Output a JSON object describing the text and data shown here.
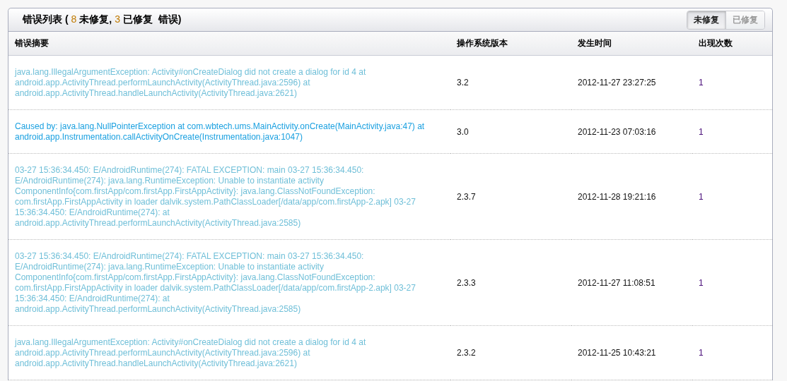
{
  "panel": {
    "title": {
      "label": "错误列表",
      "open": "(",
      "unfixed_count": "8",
      "unfixed_label": "未修复,",
      "fixed_count": "3",
      "fixed_label": "已修复",
      "suffix": "错误)"
    },
    "filter_tabs": [
      {
        "label": "未修复",
        "selected": true
      },
      {
        "label": "已修复",
        "selected": false
      }
    ]
  },
  "table": {
    "columns": [
      "错误摘要",
      "操作系统版本",
      "发生时间",
      "出现次数"
    ],
    "rows": [
      {
        "summary": "java.lang.IllegalArgumentException: Activity#onCreateDialog did not create a dialog for id 4 at android.app.ActivityThread.performLaunchActivity(ActivityThread.java:2596) at android.app.ActivityThread.handleLaunchActivity(ActivityThread.java:2621)",
        "visited": true,
        "os_version": "3.2",
        "time": "2012-11-27 23:27:25",
        "count": "1"
      },
      {
        "summary": "Caused by: java.lang.NullPointerException at com.wbtech.ums.MainActivity.onCreate(MainActivity.java:47) at android.app.Instrumentation.callActivityOnCreate(Instrumentation.java:1047)",
        "visited": false,
        "os_version": "3.0",
        "time": "2012-11-23 07:03:16",
        "count": "1"
      },
      {
        "summary": "03-27 15:36:34.450: E/AndroidRuntime(274): FATAL EXCEPTION: main 03-27 15:36:34.450: E/AndroidRuntime(274): java.lang.RuntimeException: Unable to instantiate activity ComponentInfo{com.firstApp/com.firstApp.FirstAppActivity}: java.lang.ClassNotFoundException: com.firstApp.FirstAppActivity in loader dalvik.system.PathClassLoader[/data/app/com.firstApp-2.apk] 03-27 15:36:34.450: E/AndroidRuntime(274): at android.app.ActivityThread.performLaunchActivity(ActivityThread.java:2585)",
        "visited": true,
        "os_version": "2.3.7",
        "time": "2012-11-28 19:21:16",
        "count": "1"
      },
      {
        "summary": "03-27 15:36:34.450: E/AndroidRuntime(274): FATAL EXCEPTION: main 03-27 15:36:34.450: E/AndroidRuntime(274): java.lang.RuntimeException: Unable to instantiate activity ComponentInfo{com.firstApp/com.firstApp.FirstAppActivity}: java.lang.ClassNotFoundException: com.firstApp.FirstAppActivity in loader dalvik.system.PathClassLoader[/data/app/com.firstApp-2.apk] 03-27 15:36:34.450: E/AndroidRuntime(274): at android.app.ActivityThread.performLaunchActivity(ActivityThread.java:2585)",
        "visited": true,
        "os_version": "2.3.3",
        "time": "2012-11-27 11:08:51",
        "count": "1"
      },
      {
        "summary": "java.lang.IllegalArgumentException: Activity#onCreateDialog did not create a dialog for id 4 at android.app.ActivityThread.performLaunchActivity(ActivityThread.java:2596) at android.app.ActivityThread.handleLaunchActivity(ActivityThread.java:2621)",
        "visited": true,
        "os_version": "2.3.2",
        "time": "2012-11-25 10:43:21",
        "count": "1"
      }
    ]
  }
}
